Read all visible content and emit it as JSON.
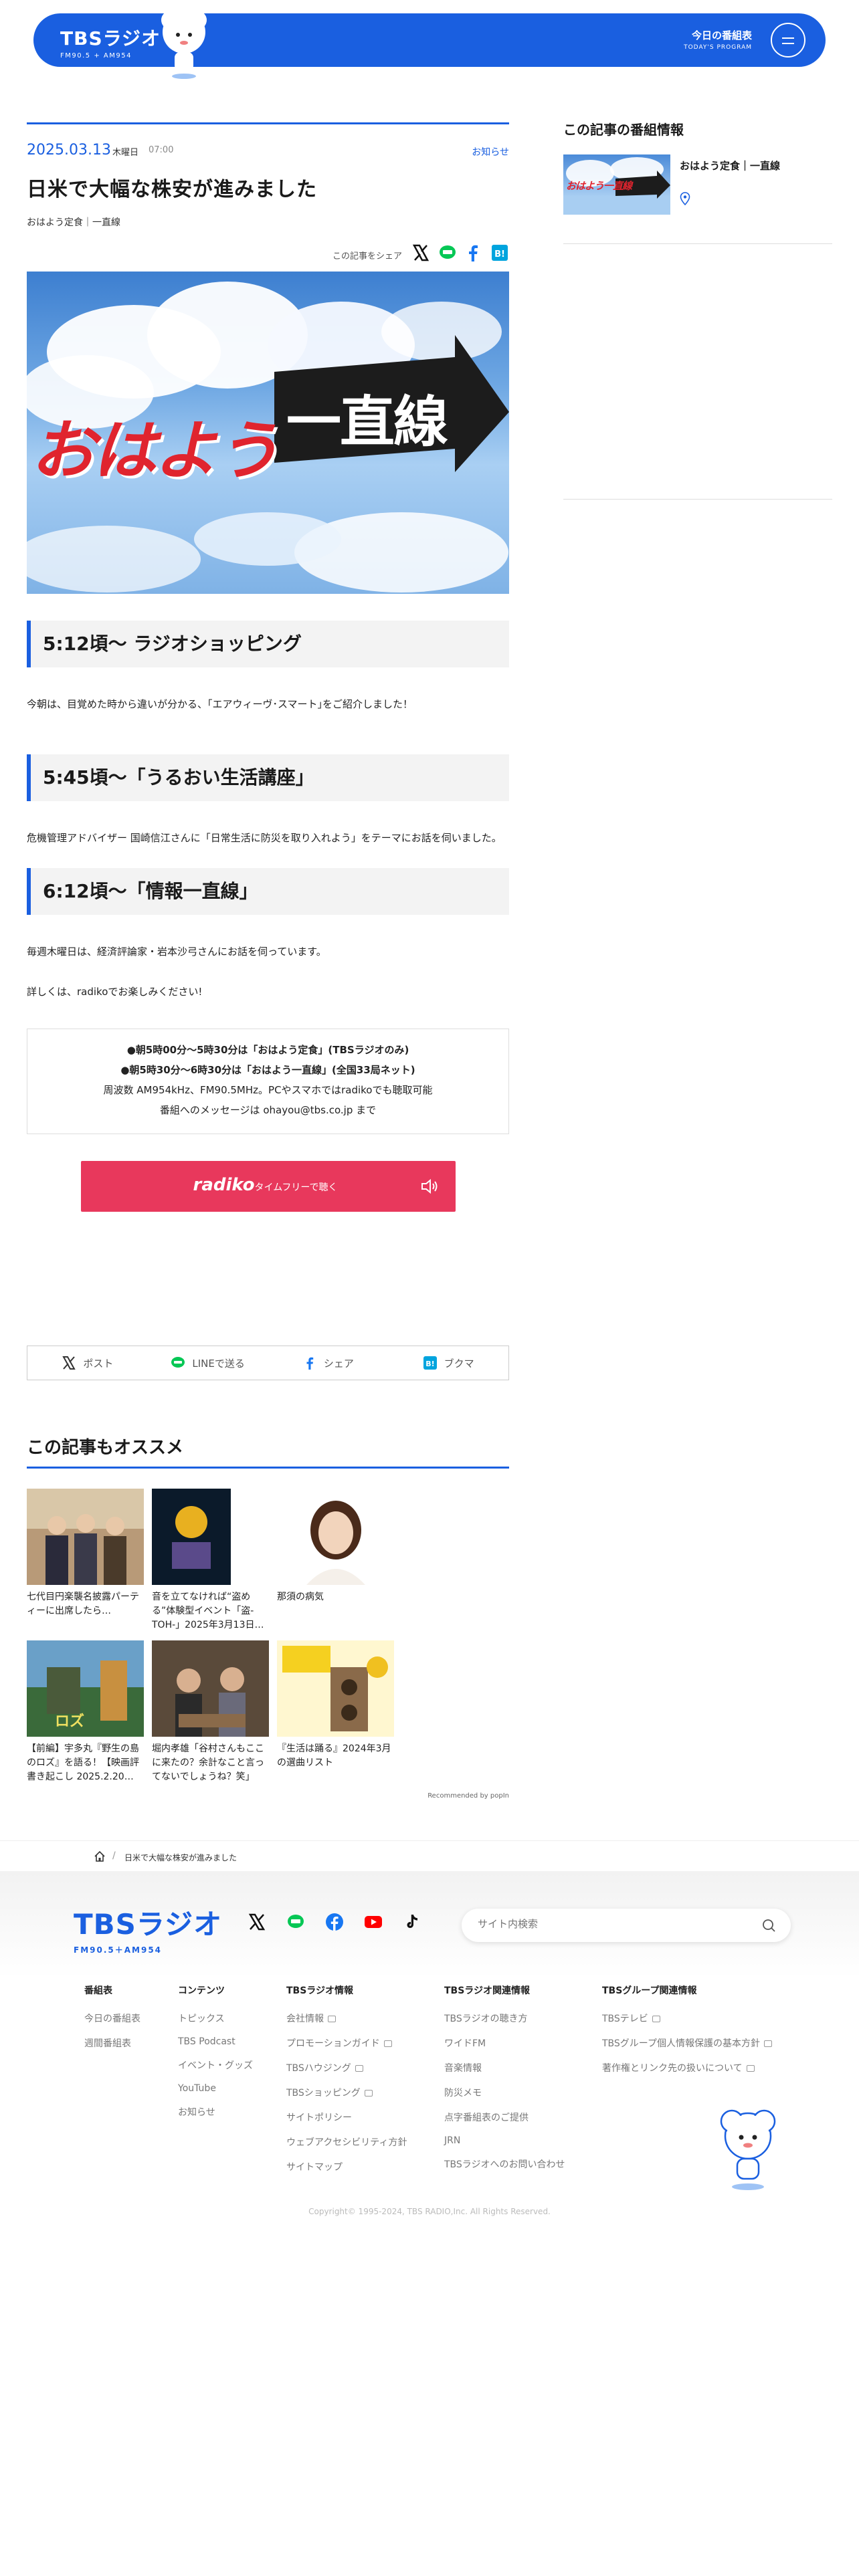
{
  "header": {
    "logo_main": "TBSラジオ",
    "logo_sub": "FM90.5 + AM954",
    "program_ja": "今日の番組表",
    "program_en": "TODAY'S PROGRAM"
  },
  "article": {
    "date": "2025.03.13",
    "weekday": "木曜日",
    "time": "07:00",
    "category": "お知らせ",
    "title": "日米で大幅な株安が進みました",
    "program": "おはよう定食｜一直線",
    "share_label": "この記事をシェア",
    "hero_text_left": "おはよう",
    "hero_text_right": "一直線",
    "sections": [
      {
        "heading": "5:12頃〜 ラジオショッピング",
        "body": "今朝は、目覚めた時から違いが分かる、｢エアウィーヴ･スマート｣をご紹介しました！"
      },
      {
        "heading": "5:45頃〜「うるおい生活講座」",
        "body": "危機管理アドバイザー 国崎信江さんに「日常生活に防災を取り入れよう」をテーマにお話を伺いました。"
      },
      {
        "heading": "6:12頃〜「情報一直線」",
        "body": "毎週木曜日は、経済評論家・岩本沙弓さんにお話を伺っています。",
        "body2": "詳しくは、radikoでお楽しみください!"
      }
    ],
    "info": {
      "line1": "●朝5時00分～5時30分は「おはよう定食」(TBSラジオのみ)",
      "line2": "●朝5時30分～6時30分は「おはよう一直線」(全国33局ネット)",
      "line3": "周波数 AM954kHz、FM90.5MHz。PCやスマホではradikoでも聴取可能",
      "line4": "番組へのメッセージは ohayou@tbs.co.jp まで"
    },
    "radiko_logo": "radiko",
    "radiko_text": "タイムフリーで聴く",
    "share_bar": {
      "post": "ポスト",
      "line": "LINEで送る",
      "share": "シェア",
      "bookmark": "ブクマ"
    }
  },
  "recommend": {
    "heading": "この記事もオススメ",
    "items": [
      {
        "caption": "七代目円楽襲名披露パーティーに出席したら…"
      },
      {
        "caption": "音を立てなければ“盗める”体験型イベント「盗-TOH-」2025年3月13日…"
      },
      {
        "caption": "那須の病気"
      },
      {
        "caption": "【前編】宇多丸『野生の島のロズ』を語る！【映画評書き起こし 2025.2.20…"
      },
      {
        "caption": "堀内孝雄「谷村さんもここに来たの？余計なこと言ってないでしょうね？笑」"
      },
      {
        "caption": "『生活は踊る』2024年3月の選曲リスト"
      }
    ],
    "powered": "Recommended by popIn"
  },
  "sidebar": {
    "heading": "この記事の番組情報",
    "program": "おはよう定食｜一直線",
    "thumb_text": "おはよう一直線"
  },
  "breadcrumb": {
    "current": "日米で大幅な株安が進みました"
  },
  "footer": {
    "logo_main": "TBSラジオ",
    "logo_sub": "FM90.5＋AM954",
    "search_placeholder": "サイト内検索",
    "columns": [
      {
        "title": "番組表",
        "links": [
          "今日の番組表",
          "週間番組表"
        ]
      },
      {
        "title": "コンテンツ",
        "links": [
          "トピックス",
          "TBS Podcast",
          "イベント・グッズ",
          "YouTube",
          "お知らせ"
        ]
      },
      {
        "title": "TBSラジオ情報",
        "links": [
          "会社情報",
          "プロモーションガイド",
          "TBSハウジング",
          "TBSショッピング",
          "サイトポリシー",
          "ウェブアクセシビリティ方針",
          "サイトマップ"
        ]
      },
      {
        "title": "TBSラジオ関連情報",
        "links": [
          "TBSラジオの聴き方",
          "ワイドFM",
          "音楽情報",
          "防災メモ",
          "点字番組表のご提供",
          "JRN",
          "TBSラジオへのお問い合わせ"
        ]
      },
      {
        "title": "TBSグループ関連情報",
        "links": [
          "TBSテレビ",
          "TBSグループ個人情報保護の基本方針",
          "著作権とリンク先の扱いについて"
        ]
      }
    ],
    "copyright": "Copyright© 1995-2024, TBS RADIO,Inc. All Rights Reserved."
  }
}
